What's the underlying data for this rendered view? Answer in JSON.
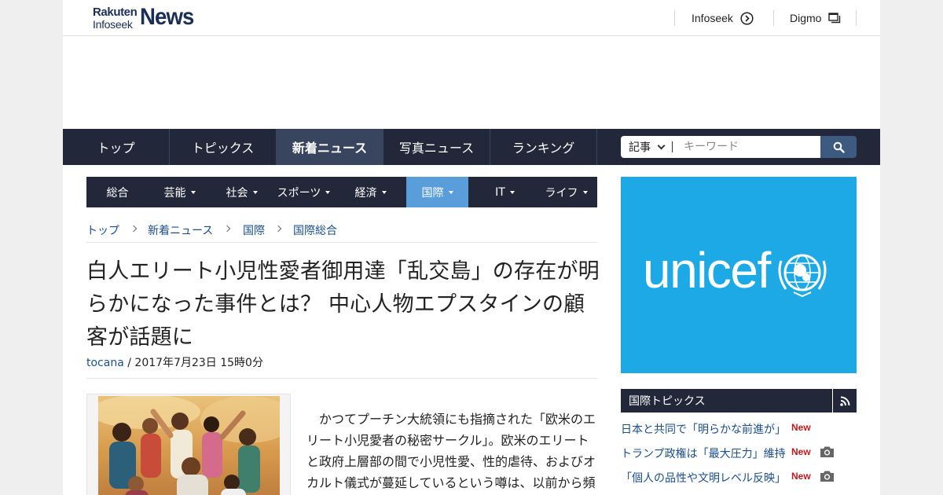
{
  "header": {
    "logo": {
      "line1": "Rakuten",
      "line2": "Infoseek",
      "line3": "News"
    },
    "links": [
      {
        "label": "Infoseek",
        "icon": "circle-arrow-right-icon"
      },
      {
        "label": "Digmo",
        "icon": "windows-icon"
      }
    ]
  },
  "main_nav": {
    "items": [
      "トップ",
      "トピックス",
      "新着ニュース",
      "写真ニュース",
      "ランキング"
    ],
    "active": "新着ニュース"
  },
  "search": {
    "scope_selected": "記事",
    "placeholder": "キーワード",
    "button_icon": "search-icon"
  },
  "sub_nav": {
    "items": [
      "総合",
      "芸能",
      "社会",
      "スポーツ",
      "経済",
      "国際",
      "IT",
      "ライフ"
    ],
    "active": "国際",
    "has_dropdown": [
      false,
      true,
      true,
      true,
      true,
      true,
      true,
      true
    ]
  },
  "breadcrumb": [
    "トップ",
    "新着ニュース",
    "国際",
    "国際総合"
  ],
  "article": {
    "title": "白人エリート小児性愛者御用達「乱交島」の存在が明らかになった事件とは？ 中心人物エプスタインの顧客が話題に",
    "source": "tocana",
    "date": "2017年7月23日 15時0分",
    "body": "かつてプーチン大統領にも指摘された「欧米のエリート小児愛者の秘密サークル」。欧米のエリートと政府上層部の間で小児性愛、性的虐待、およびオカルト儀式が蔓延しているという噂は、以前から頻繁にささやかれてきた。そんな中、米国の元金持"
  },
  "ad": {
    "text": "unicef"
  },
  "topics": {
    "title": "国際トピックス",
    "items": [
      {
        "text": "日本と共同で「明らかな前進が」",
        "badge": "New",
        "has_photo": false
      },
      {
        "text": "トランプ政権は「最大圧力」維持",
        "badge": "New",
        "has_photo": true
      },
      {
        "text": "「個人の品性や文明レベル反映」",
        "badge": "New",
        "has_photo": true
      }
    ]
  },
  "colors": {
    "navy": "#22283a",
    "nav_active": "#39445e",
    "subnav_active": "#5a9ddb",
    "link": "#1a4d8f",
    "new_badge": "#c4181e",
    "unicef": "#1ca9e6"
  }
}
